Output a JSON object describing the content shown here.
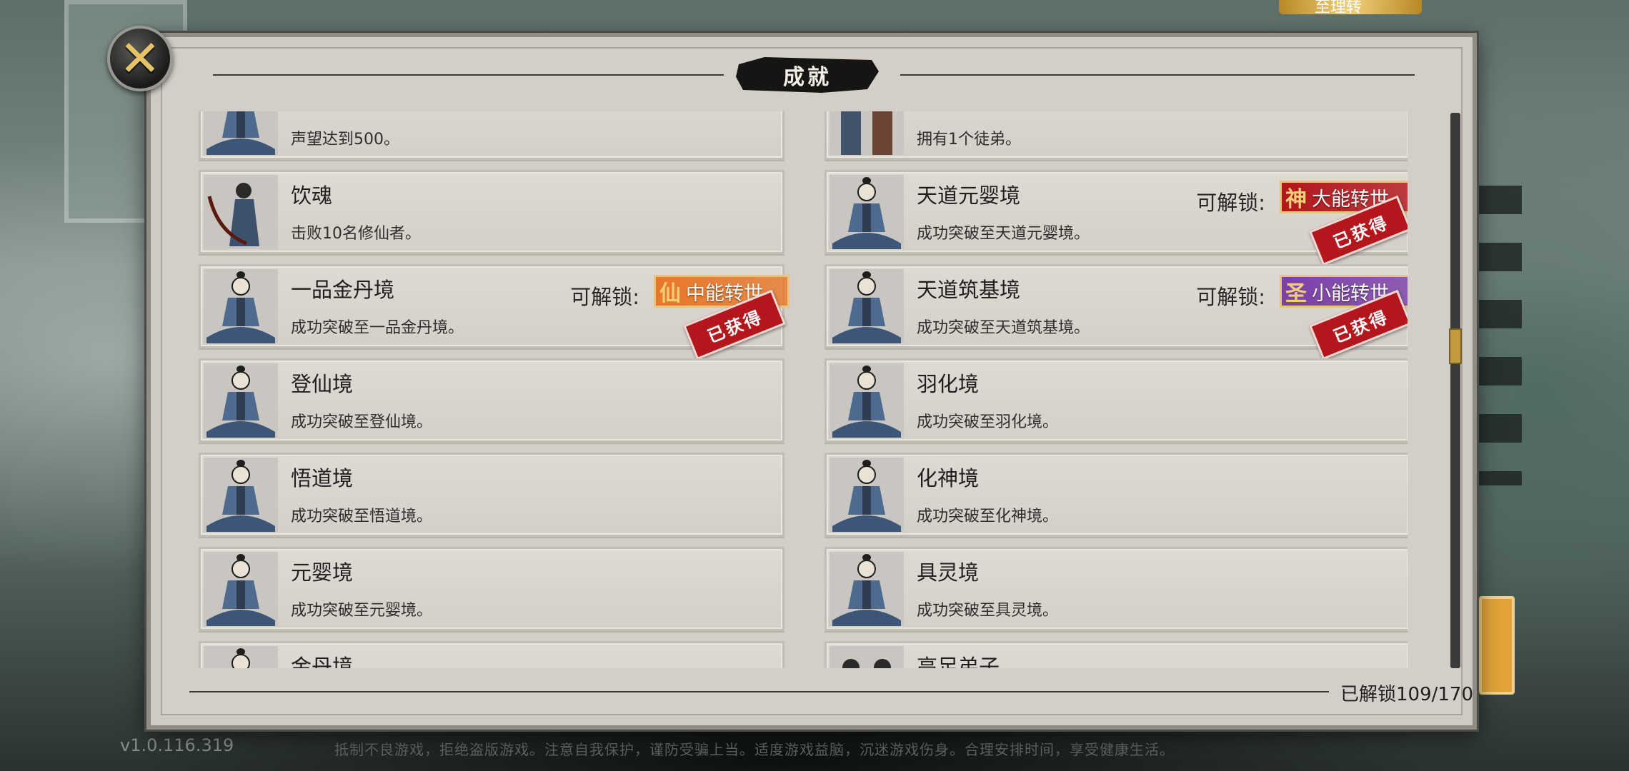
{
  "dialog": {
    "title": "成就",
    "counter_label": "已解锁109/170",
    "close_icon": "close-x-icon"
  },
  "footer": {
    "version": "v1.0.116.319",
    "health_tip": "抵制不良游戏，拒绝盗版游戏。注意自我保护，谨防受骗上当。适度游戏益脑，沉迷游戏伤身。合理安排时间，享受健康生活。"
  },
  "top_banner": {
    "text": "至理转"
  },
  "achievements": [
    {
      "title": "",
      "desc": "声望达到500。",
      "avatar": "meditating-cultivator-icon"
    },
    {
      "title": "",
      "desc": "拥有1个徒弟。",
      "avatar": "two-figures-icon"
    },
    {
      "title": "饮魂",
      "desc": "击败10名修仙者。",
      "avatar": "swordsman-icon"
    },
    {
      "title": "天道元婴境",
      "desc": "成功突破至天道元婴境。",
      "avatar": "meditating-cultivator-icon",
      "unlock_label": "可解锁:",
      "reward_glyph": "神",
      "reward_name": "大能转世",
      "reward_color": "#b3161b",
      "stamp": "已获得"
    },
    {
      "title": "一品金丹境",
      "desc": "成功突破至一品金丹境。",
      "avatar": "meditating-cultivator-icon",
      "unlock_label": "可解锁:",
      "reward_glyph": "仙",
      "reward_name": "中能转世",
      "reward_color": "#e8772a",
      "stamp": "已获得"
    },
    {
      "title": "天道筑基境",
      "desc": "成功突破至天道筑基境。",
      "avatar": "meditating-cultivator-icon",
      "unlock_label": "可解锁:",
      "reward_glyph": "圣",
      "reward_name": "小能转世",
      "reward_color": "#7b3fa8",
      "stamp": "已获得"
    },
    {
      "title": "登仙境",
      "desc": "成功突破至登仙境。",
      "avatar": "meditating-cultivator-icon"
    },
    {
      "title": "羽化境",
      "desc": "成功突破至羽化境。",
      "avatar": "meditating-cultivator-icon"
    },
    {
      "title": "悟道境",
      "desc": "成功突破至悟道境。",
      "avatar": "meditating-cultivator-icon"
    },
    {
      "title": "化神境",
      "desc": "成功突破至化神境。",
      "avatar": "meditating-cultivator-icon"
    },
    {
      "title": "元婴境",
      "desc": "成功突破至元婴境。",
      "avatar": "meditating-cultivator-icon"
    },
    {
      "title": "具灵境",
      "desc": "成功突破至具灵境。",
      "avatar": "meditating-cultivator-icon"
    },
    {
      "title": "金丹境",
      "desc": "",
      "avatar": "meditating-cultivator-icon"
    },
    {
      "title": "高足弟子",
      "desc": "",
      "avatar": "two-figures-icon"
    }
  ]
}
